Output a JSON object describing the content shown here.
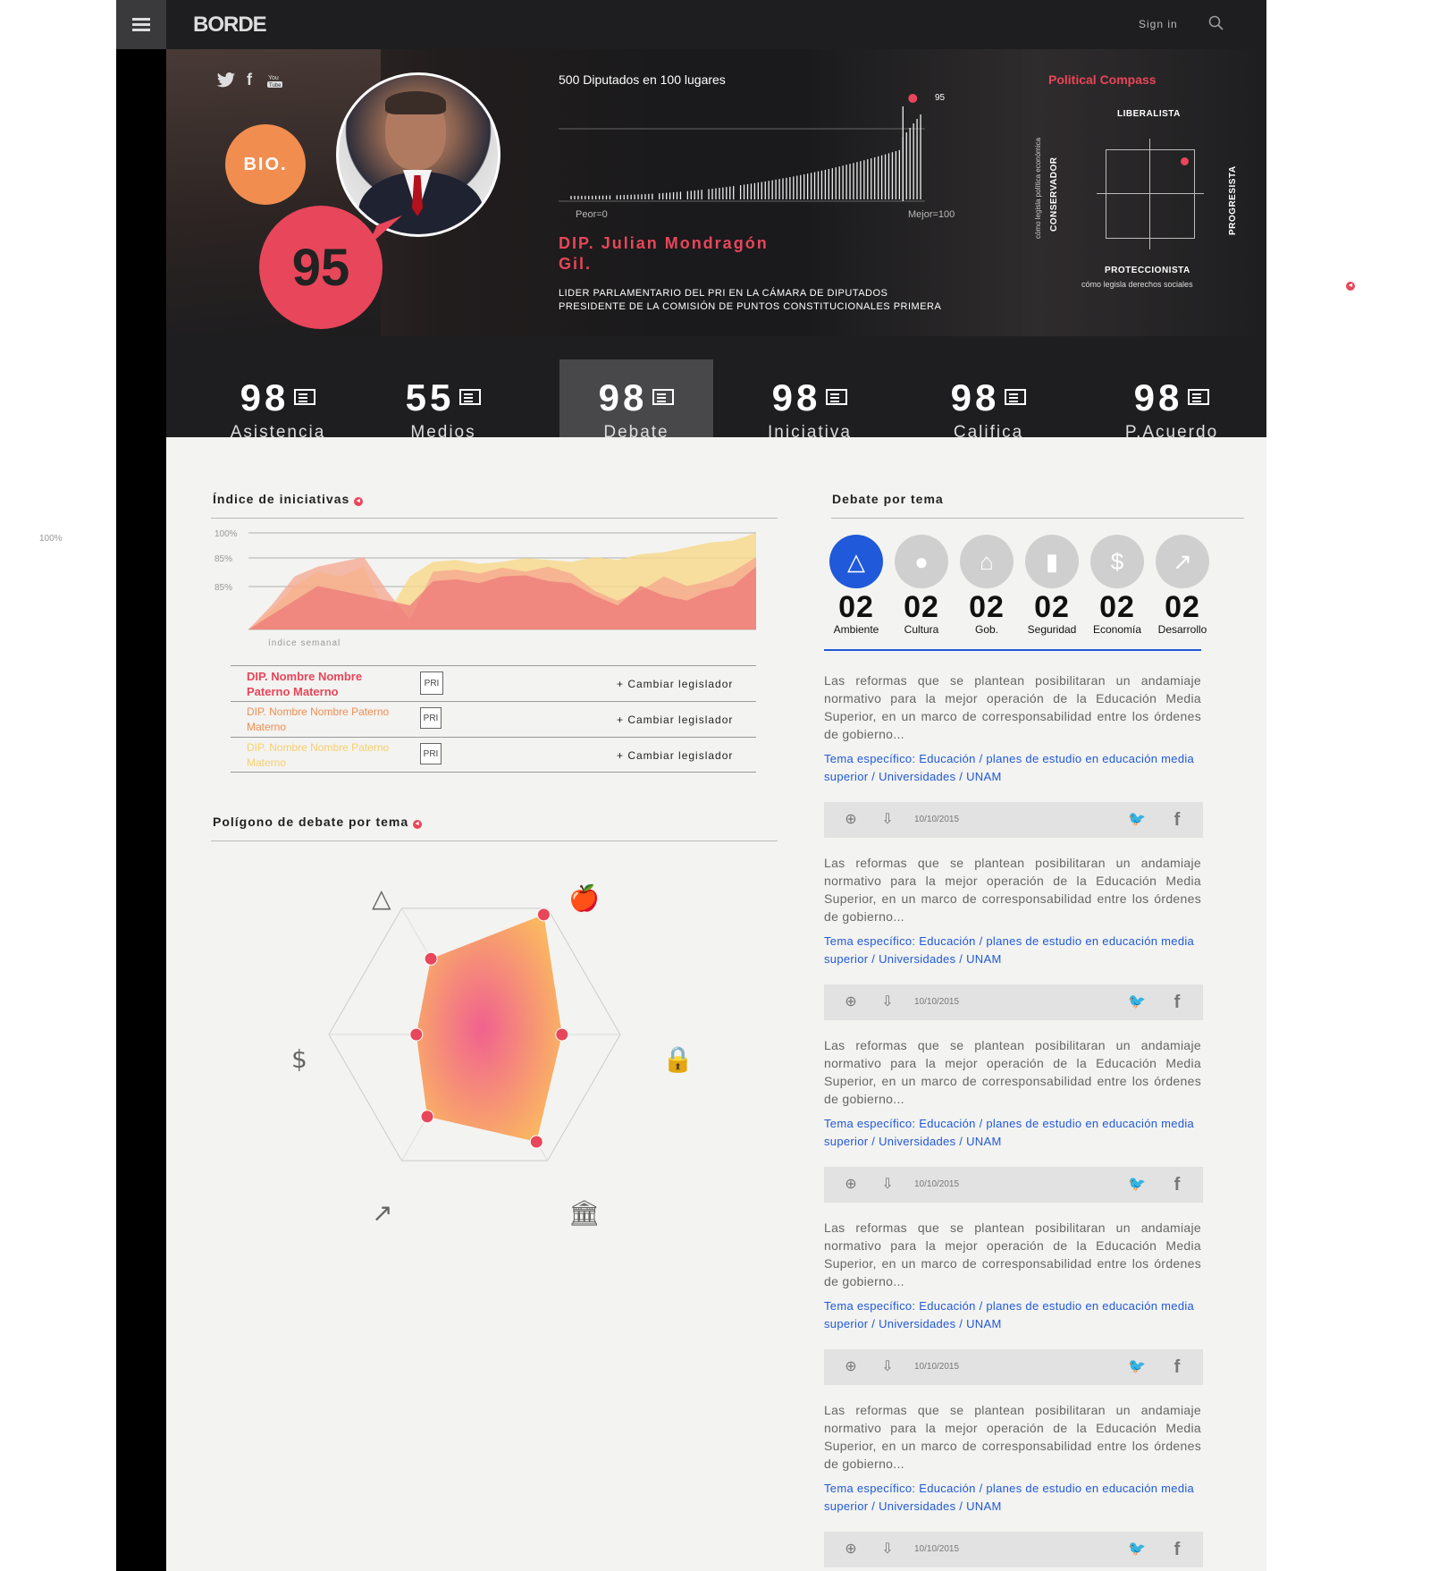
{
  "nav": {
    "logo": "BORDE",
    "signin": "Sign in"
  },
  "hero": {
    "bio": "BIO.",
    "score": "95",
    "rank_title": "500 Diputados en 100 lugares",
    "rank_marker": "95",
    "peor": "Peor=0",
    "mejor": "Mejor=100",
    "name": "DIP. Julian Mondragón Gil.",
    "desc_line1": "LIDER PARLAMENTARIO DEL PRI EN LA CÁMARA DE DIPUTADOS",
    "desc_line2": "PRESIDENTE DE LA COMISIÓN DE PUNTOS CONSTITUCIONALES PRIMERA",
    "social": [
      "twitter-icon",
      "facebook-icon",
      "youtube-icon"
    ]
  },
  "compass": {
    "title": "Political Compass",
    "top": "LIBERALISTA",
    "bottom": "PROTECCIONISTA",
    "bottom_sub": "cómo legisla derechos sociales",
    "left": "CONSERVADOR",
    "left_sub": "cómo legisla política económica",
    "right": "PROGRESISTA"
  },
  "stats": [
    {
      "value": "98",
      "label": "Asistencia"
    },
    {
      "value": "55",
      "label": "Medios"
    },
    {
      "value": "98",
      "label": "Debate",
      "active": true
    },
    {
      "value": "98",
      "label": "Iniciativa"
    },
    {
      "value": "98",
      "label": "Califica"
    },
    {
      "value": "98",
      "label": "P.Acuerdo"
    }
  ],
  "side_label": "100%",
  "iniciativas": {
    "title": "Índice de iniciativas",
    "xlabel": "índice semanal",
    "legislators": [
      {
        "name": "DIP. Nombre Nombre Paterno Materno",
        "change": "+  Cambiar legislador",
        "color": "#e8465a"
      },
      {
        "name": "DIP. Nombre Nombre Paterno Materno",
        "change": "+  Cambiar legislador",
        "color": "#f28d50"
      },
      {
        "name": "DIP. Nombre Nombre Paterno Materno",
        "change": "+  Cambiar legislador",
        "color": "#f7cf6c"
      }
    ]
  },
  "chart_data": {
    "type": "area",
    "xlabel": "índice semanal",
    "ylabel": "",
    "y_ticks": [
      "100%",
      "85%",
      "85%"
    ],
    "series": [
      {
        "color": "#f7d88a",
        "values": [
          0,
          20,
          45,
          60,
          55,
          65,
          15,
          55,
          70,
          72,
          68,
          70,
          74,
          72,
          70,
          75,
          72,
          78,
          80,
          85,
          90,
          92,
          100
        ]
      },
      {
        "color": "#f5a58e",
        "values": [
          0,
          25,
          55,
          65,
          70,
          75,
          40,
          10,
          60,
          62,
          58,
          64,
          60,
          65,
          58,
          40,
          30,
          40,
          55,
          45,
          50,
          60,
          75
        ]
      },
      {
        "color": "#ee7a78",
        "values": [
          0,
          15,
          30,
          45,
          40,
          35,
          30,
          25,
          50,
          52,
          48,
          55,
          56,
          50,
          48,
          35,
          25,
          45,
          35,
          30,
          40,
          45,
          65
        ]
      }
    ]
  },
  "poligono": {
    "title": "Polígono de debate por tema",
    "axes": [
      "triangle-recycle-icon",
      "apple-book-icon",
      "lock-icon",
      "bank-icon",
      "growth-chart-icon",
      "coins-icon"
    ],
    "values": [
      0.6,
      0.95,
      0.6,
      0.85,
      0.65,
      0.4
    ]
  },
  "debate": {
    "title": "Debate por tema",
    "topics": [
      {
        "count": "02",
        "label": "Ambiente",
        "icon": "triangle-recycle-icon",
        "active": true
      },
      {
        "count": "02",
        "label": "Cultura",
        "icon": "apple-book-icon"
      },
      {
        "count": "02",
        "label": "Gob.",
        "icon": "bank-icon"
      },
      {
        "count": "02",
        "label": "Seguridad",
        "icon": "lock-icon"
      },
      {
        "count": "02",
        "label": "Economía",
        "icon": "coins-icon"
      },
      {
        "count": "02",
        "label": "Desarrollo",
        "icon": "growth-chart-icon"
      }
    ],
    "articles": [
      {
        "text": "Las reformas que se plantean posibilitaran un andamiaje normativo para la mejor operación de la Educación Media Superior, en un marco de corresponsabilidad entre los órdenes de gobierno...",
        "tema": "Tema específico: Educación / planes de estudio en educación media superior / Universidades / UNAM",
        "date": "10/10/2015"
      },
      {
        "text": "Las reformas que se plantean posibilitaran un andamiaje normativo para la mejor operación de la Educación Media Superior, en un marco de corresponsabilidad entre los órdenes de gobierno...",
        "tema": "Tema específico: Educación / planes de estudio en educación media superior / Universidades / UNAM",
        "date": "10/10/2015"
      },
      {
        "text": "Las reformas que se plantean posibilitaran un andamiaje normativo para la mejor operación de la Educación Media Superior, en un marco de corresponsabilidad entre los órdenes de gobierno...",
        "tema": "Tema específico: Educación / planes de estudio en educación media superior / Universidades / UNAM",
        "date": "10/10/2015"
      },
      {
        "text": "Las reformas que se plantean posibilitaran un andamiaje normativo para la mejor operación de la Educación Media Superior, en un marco de corresponsabilidad entre los órdenes de gobierno...",
        "tema": "Tema específico: Educación / planes de estudio en educación media superior / Universidades / UNAM",
        "date": "10/10/2015"
      },
      {
        "text": "Las reformas que se plantean posibilitaran un andamiaje normativo para la mejor operación de la Educación Media Superior, en un marco de corresponsabilidad entre los órdenes de gobierno...",
        "tema": "Tema específico: Educación / planes de estudio en educación media superior / Universidades / UNAM",
        "date": "10/10/2015"
      }
    ]
  }
}
